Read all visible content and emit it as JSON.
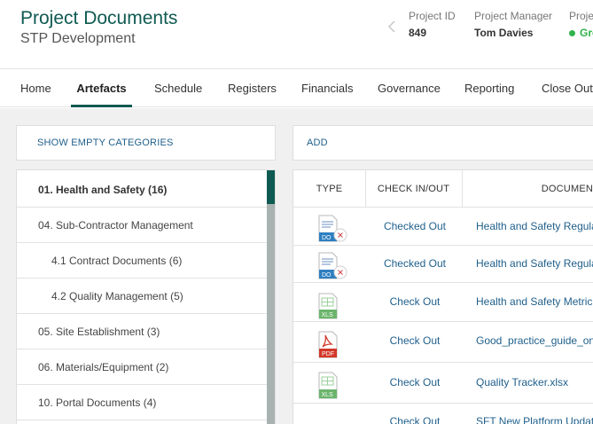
{
  "header": {
    "title": "Project Documents",
    "subtitle": "STP Development",
    "project_id_label": "Project ID",
    "project_id": "849",
    "manager_label": "Project Manager",
    "manager": "Tom Davies",
    "status_label": "Proje",
    "status": "Gre",
    "status_color": "#2fb24c"
  },
  "nav": {
    "items": [
      "Home",
      "Artefacts",
      "Schedule",
      "Registers",
      "Financials",
      "Governance",
      "Reporting",
      "Close Out"
    ],
    "active": "Artefacts"
  },
  "toolbar": {
    "show_empty": "SHOW EMPTY CATEGORIES",
    "add": "ADD"
  },
  "categories": [
    "01. Health and Safety (16)",
    "04. Sub-Contractor Management",
    "4.1 Contract Documents (6)",
    "4.2 Quality Management (5)",
    "05. Site Establishment (3)",
    "06. Materials/Equipment (2)",
    "10. Portal Documents (4)"
  ],
  "table": {
    "headers": [
      "TYPE",
      "CHECK IN/OUT",
      "DOCUMEN"
    ],
    "rows": [
      {
        "type": "DOC",
        "check": "Checked Out",
        "doc": "Health and Safety Regula"
      },
      {
        "type": "DOC",
        "check": "Checked Out",
        "doc": "Health and Safety Regula"
      },
      {
        "type": "XLS",
        "check": "Check Out",
        "doc": "Health and Safety Metric"
      },
      {
        "type": "PDF",
        "check": "Check Out",
        "doc": "Good_practice_guide_on"
      },
      {
        "type": "XLS",
        "check": "Check Out",
        "doc": "Quality Tracker.xlsx"
      },
      {
        "type": "",
        "check": "Check Out",
        "doc": "SFT New Platform Updat"
      }
    ]
  },
  "colors": {
    "brand": "#0f5a52",
    "link": "#1f5f8b",
    "doc": "#2e7fc1",
    "xls": "#6ab56b",
    "pdf": "#d2382a"
  }
}
